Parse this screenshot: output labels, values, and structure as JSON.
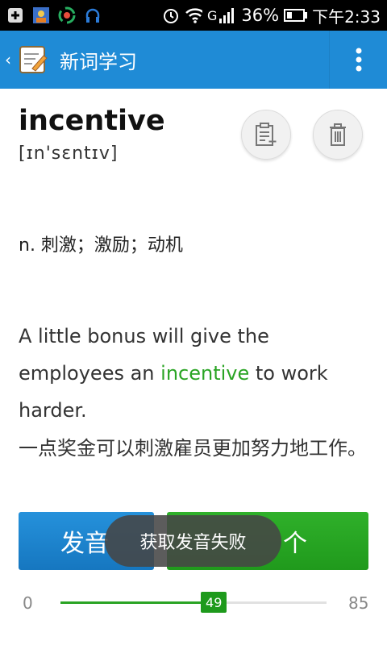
{
  "status_bar": {
    "network": "G",
    "battery": "36%",
    "time": "下午2:33",
    "battery_level": 0.36
  },
  "app_bar": {
    "title": "新词学习",
    "logo_icon": "notebook-pencil-icon",
    "overflow_icon": "vertical-dots-icon"
  },
  "word": {
    "text": "incentive",
    "phonetic": "[ɪn'sɛntɪv]"
  },
  "actions": {
    "add_note_icon": "note-add-icon",
    "delete_icon": "trash-icon"
  },
  "definition": "n. 刺激；激励；动机",
  "example": {
    "before": "A little bonus will give the employees an ",
    "highlight": "incentive",
    "after": " to work harder.",
    "translation": "一点奖金可以刺激雇员更加努力地工作。"
  },
  "buttons": {
    "pronounce_label": "发音",
    "next_label": "个"
  },
  "toast": "获取发音失败",
  "progress": {
    "min": "0",
    "max": "85",
    "current": "49",
    "fraction": 0.5765
  },
  "colors": {
    "app_bar": "#1f8bd6",
    "accent_green": "#2aa424",
    "pronounce_blue": "#1f86d0"
  }
}
